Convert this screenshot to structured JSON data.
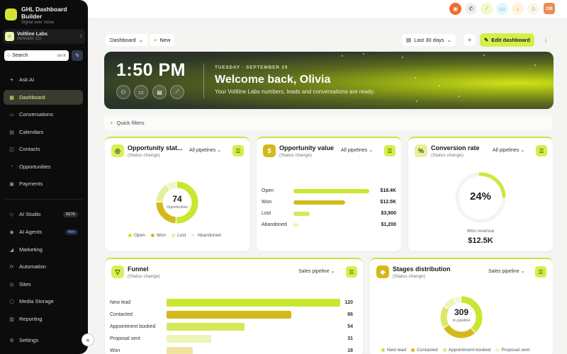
{
  "app": {
    "title": "GHL Dashboard Builder",
    "tagline": "Signal over noise",
    "logo_glyph": "⚡"
  },
  "account": {
    "initial": "⌂",
    "name": "Voltline Labs",
    "location": "DENVER, CO"
  },
  "search": {
    "placeholder": "Search",
    "shortcut": "ctrl K"
  },
  "nav": [
    {
      "label": "Ask AI",
      "icon": "sparkle-icon"
    },
    {
      "label": "Dashboard",
      "icon": "dashboard-icon",
      "active": true
    },
    {
      "label": "Conversations",
      "icon": "chat-icon"
    },
    {
      "label": "Calendars",
      "icon": "calendar-icon"
    },
    {
      "label": "Contacts",
      "icon": "contacts-icon"
    },
    {
      "label": "Opportunities",
      "icon": "opportunities-icon"
    },
    {
      "label": "Payments",
      "icon": "payments-icon"
    },
    {
      "label": "AI Studio",
      "icon": "ai-studio-icon",
      "badge": "BETA"
    },
    {
      "label": "AI Agents",
      "icon": "ai-agents-icon",
      "badge": "New"
    },
    {
      "label": "Marketing",
      "icon": "marketing-icon"
    },
    {
      "label": "Automation",
      "icon": "automation-icon"
    },
    {
      "label": "Sites",
      "icon": "sites-icon"
    },
    {
      "label": "Media Storage",
      "icon": "media-icon"
    },
    {
      "label": "Reporting",
      "icon": "reporting-icon"
    },
    {
      "label": "Settings",
      "icon": "gear-icon"
    }
  ],
  "topbar": {
    "user_initials": "OB"
  },
  "header": {
    "dashboard_select": "Dashboard",
    "new_label": "New",
    "date_range": "Last 30 days",
    "edit_label": "Edit dashboard"
  },
  "hero": {
    "time": "1:50 PM",
    "date": "TUESDAY · SEPTEMBER 29",
    "welcome": "Welcome back, Olivia",
    "subtitle": "Your Voltline Labs numbers, leads and conversations are ready."
  },
  "quick_filters_label": "Quick filters",
  "cards": {
    "opp_status": {
      "title": "Opportunity stat...",
      "sub": "(Status change)",
      "pipeline": "All pipelines",
      "total": "74",
      "total_label": "Opportunities",
      "legend": [
        "Open",
        "Won",
        "Lost",
        "Abandoned"
      ]
    },
    "opp_value": {
      "title": "Opportunity value",
      "sub": "(Status change)",
      "pipeline": "All pipelines",
      "rows": [
        {
          "label": "Open",
          "value": "$18.4K"
        },
        {
          "label": "Won",
          "value": "$12.5K"
        },
        {
          "label": "Lost",
          "value": "$3,900"
        },
        {
          "label": "Abandoned",
          "value": "$1,200"
        }
      ]
    },
    "conversion": {
      "title": "Conversion rate",
      "sub": "(Status change)",
      "pipeline": "All pipelines",
      "rate": "24%",
      "rate_value": 24,
      "won_label": "Won revenue",
      "won_value": "$12.5K"
    },
    "funnel": {
      "title": "Funnel",
      "sub": "(Status change)",
      "pipeline": "Sales pipeline",
      "rows": [
        {
          "label": "New lead",
          "value": "120"
        },
        {
          "label": "Contacted",
          "value": "86"
        },
        {
          "label": "Appointment booked",
          "value": "54"
        },
        {
          "label": "Proposal sent",
          "value": "31"
        },
        {
          "label": "Won",
          "value": "18"
        }
      ]
    },
    "stages": {
      "title": "Stages distribution",
      "sub": "(Status change)",
      "pipeline": "Sales pipeline",
      "total": "309",
      "total_label": "in pipeline",
      "legend": [
        "New lead",
        "Contacted",
        "Appointment booked",
        "Proposal sent"
      ]
    }
  },
  "chart_data": [
    {
      "type": "pie",
      "title": "Opportunity stat...",
      "categories": [
        "Open",
        "Won",
        "Lost",
        "Abandoned"
      ],
      "values": [
        38,
        18,
        12,
        6
      ]
    },
    {
      "type": "bar",
      "title": "Opportunity value",
      "categories": [
        "Open",
        "Won",
        "Lost",
        "Abandoned"
      ],
      "values": [
        18400,
        12500,
        3900,
        1200
      ]
    },
    {
      "type": "bar",
      "title": "Funnel",
      "categories": [
        "New lead",
        "Contacted",
        "Appointment booked",
        "Proposal sent",
        "Won"
      ],
      "values": [
        120,
        86,
        54,
        31,
        18
      ]
    },
    {
      "type": "pie",
      "title": "Stages distribution",
      "categories": [
        "New lead",
        "Contacted",
        "Appointment booked",
        "Proposal sent",
        "Won"
      ],
      "values": [
        120,
        86,
        54,
        31,
        18
      ]
    }
  ],
  "colors": {
    "accent": "#d6ee4c",
    "lime": "#c6e82f",
    "olive": "#d4b91a",
    "pale": "#e7ef9c",
    "paler": "#f1f5c9"
  }
}
